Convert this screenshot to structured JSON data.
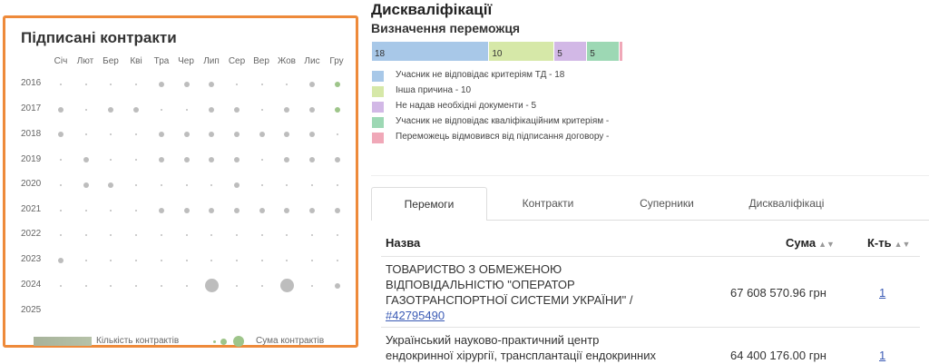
{
  "contracts_chart": {
    "title": "Підписані контракти",
    "months": [
      "Січ",
      "Лют",
      "Бер",
      "Кві",
      "Тра",
      "Чер",
      "Лип",
      "Сер",
      "Вер",
      "Жов",
      "Лис",
      "Гру"
    ],
    "years": [
      "2016",
      "2017",
      "2018",
      "2019",
      "2020",
      "2021",
      "2022",
      "2023",
      "2024",
      "2025"
    ],
    "legend_count_label": "Кількість контрактів",
    "legend_sum_label": "Сума контрактів",
    "colors": {
      "small": "#bdbdbd",
      "green": "#9ec58a",
      "border": "#ee8a3a"
    }
  },
  "chart_data": {
    "type": "scatter",
    "title": "Підписані контракти",
    "x_categories": [
      "Січ",
      "Лют",
      "Бер",
      "Кві",
      "Тра",
      "Чер",
      "Лип",
      "Сер",
      "Вер",
      "Жов",
      "Лис",
      "Гру"
    ],
    "y_categories": [
      "2016",
      "2017",
      "2018",
      "2019",
      "2020",
      "2021",
      "2022",
      "2023",
      "2024",
      "2025"
    ],
    "points": [
      {
        "year": "2016",
        "month": "Січ",
        "size": 1
      },
      {
        "year": "2016",
        "month": "Лют",
        "size": 1
      },
      {
        "year": "2016",
        "month": "Бер",
        "size": 1
      },
      {
        "year": "2016",
        "month": "Кві",
        "size": 1
      },
      {
        "year": "2016",
        "month": "Тра",
        "size": 2
      },
      {
        "year": "2016",
        "month": "Чер",
        "size": 2
      },
      {
        "year": "2016",
        "month": "Лип",
        "size": 2
      },
      {
        "year": "2016",
        "month": "Сер",
        "size": 1
      },
      {
        "year": "2016",
        "month": "Вер",
        "size": 1
      },
      {
        "year": "2016",
        "month": "Жов",
        "size": 1
      },
      {
        "year": "2016",
        "month": "Лис",
        "size": 2
      },
      {
        "year": "2016",
        "month": "Гру",
        "size": 2,
        "green": true
      },
      {
        "year": "2017",
        "month": "Січ",
        "size": 2
      },
      {
        "year": "2017",
        "month": "Лют",
        "size": 1
      },
      {
        "year": "2017",
        "month": "Бер",
        "size": 2
      },
      {
        "year": "2017",
        "month": "Кві",
        "size": 2
      },
      {
        "year": "2017",
        "month": "Тра",
        "size": 1
      },
      {
        "year": "2017",
        "month": "Чер",
        "size": 1
      },
      {
        "year": "2017",
        "month": "Лип",
        "size": 2
      },
      {
        "year": "2017",
        "month": "Сер",
        "size": 2
      },
      {
        "year": "2017",
        "month": "Вер",
        "size": 1
      },
      {
        "year": "2017",
        "month": "Жов",
        "size": 2
      },
      {
        "year": "2017",
        "month": "Лис",
        "size": 2
      },
      {
        "year": "2017",
        "month": "Гру",
        "size": 2,
        "green": true
      },
      {
        "year": "2018",
        "month": "Січ",
        "size": 2
      },
      {
        "year": "2018",
        "month": "Лют",
        "size": 1
      },
      {
        "year": "2018",
        "month": "Бер",
        "size": 1
      },
      {
        "year": "2018",
        "month": "Кві",
        "size": 1
      },
      {
        "year": "2018",
        "month": "Тра",
        "size": 2
      },
      {
        "year": "2018",
        "month": "Чер",
        "size": 2
      },
      {
        "year": "2018",
        "month": "Лип",
        "size": 2
      },
      {
        "year": "2018",
        "month": "Сер",
        "size": 2
      },
      {
        "year": "2018",
        "month": "Вер",
        "size": 2
      },
      {
        "year": "2018",
        "month": "Жов",
        "size": 2
      },
      {
        "year": "2018",
        "month": "Лис",
        "size": 2
      },
      {
        "year": "2018",
        "month": "Гру",
        "size": 1
      },
      {
        "year": "2019",
        "month": "Січ",
        "size": 1
      },
      {
        "year": "2019",
        "month": "Лют",
        "size": 2
      },
      {
        "year": "2019",
        "month": "Бер",
        "size": 1
      },
      {
        "year": "2019",
        "month": "Кві",
        "size": 1
      },
      {
        "year": "2019",
        "month": "Тра",
        "size": 2
      },
      {
        "year": "2019",
        "month": "Чер",
        "size": 2
      },
      {
        "year": "2019",
        "month": "Лип",
        "size": 2
      },
      {
        "year": "2019",
        "month": "Сер",
        "size": 2
      },
      {
        "year": "2019",
        "month": "Вер",
        "size": 1
      },
      {
        "year": "2019",
        "month": "Жов",
        "size": 2
      },
      {
        "year": "2019",
        "month": "Лис",
        "size": 2
      },
      {
        "year": "2019",
        "month": "Гру",
        "size": 2
      },
      {
        "year": "2020",
        "month": "Січ",
        "size": 1
      },
      {
        "year": "2020",
        "month": "Лют",
        "size": 2
      },
      {
        "year": "2020",
        "month": "Бер",
        "size": 2
      },
      {
        "year": "2020",
        "month": "Кві",
        "size": 1
      },
      {
        "year": "2020",
        "month": "Тра",
        "size": 1
      },
      {
        "year": "2020",
        "month": "Чер",
        "size": 1
      },
      {
        "year": "2020",
        "month": "Лип",
        "size": 1
      },
      {
        "year": "2020",
        "month": "Сер",
        "size": 2
      },
      {
        "year": "2020",
        "month": "Вер",
        "size": 1
      },
      {
        "year": "2020",
        "month": "Жов",
        "size": 1
      },
      {
        "year": "2020",
        "month": "Лис",
        "size": 1
      },
      {
        "year": "2020",
        "month": "Гру",
        "size": 1
      },
      {
        "year": "2021",
        "month": "Січ",
        "size": 1
      },
      {
        "year": "2021",
        "month": "Лют",
        "size": 1
      },
      {
        "year": "2021",
        "month": "Бер",
        "size": 1
      },
      {
        "year": "2021",
        "month": "Кві",
        "size": 1
      },
      {
        "year": "2021",
        "month": "Тра",
        "size": 2
      },
      {
        "year": "2021",
        "month": "Чер",
        "size": 2
      },
      {
        "year": "2021",
        "month": "Лип",
        "size": 2
      },
      {
        "year": "2021",
        "month": "Сер",
        "size": 2
      },
      {
        "year": "2021",
        "month": "Вер",
        "size": 2
      },
      {
        "year": "2021",
        "month": "Жов",
        "size": 2
      },
      {
        "year": "2021",
        "month": "Лис",
        "size": 2
      },
      {
        "year": "2021",
        "month": "Гру",
        "size": 2
      },
      {
        "year": "2022",
        "month": "Січ",
        "size": 1
      },
      {
        "year": "2022",
        "month": "Лют",
        "size": 1
      },
      {
        "year": "2022",
        "month": "Бер",
        "size": 1
      },
      {
        "year": "2022",
        "month": "Кві",
        "size": 1
      },
      {
        "year": "2022",
        "month": "Тра",
        "size": 1
      },
      {
        "year": "2022",
        "month": "Чер",
        "size": 1
      },
      {
        "year": "2022",
        "month": "Лип",
        "size": 1
      },
      {
        "year": "2022",
        "month": "Сер",
        "size": 1
      },
      {
        "year": "2022",
        "month": "Вер",
        "size": 1
      },
      {
        "year": "2022",
        "month": "Жов",
        "size": 1
      },
      {
        "year": "2022",
        "month": "Лис",
        "size": 1
      },
      {
        "year": "2022",
        "month": "Гру",
        "size": 1
      },
      {
        "year": "2023",
        "month": "Січ",
        "size": 2
      },
      {
        "year": "2023",
        "month": "Лют",
        "size": 1
      },
      {
        "year": "2023",
        "month": "Бер",
        "size": 1
      },
      {
        "year": "2023",
        "month": "Кві",
        "size": 1
      },
      {
        "year": "2023",
        "month": "Тра",
        "size": 1
      },
      {
        "year": "2023",
        "month": "Чер",
        "size": 1
      },
      {
        "year": "2023",
        "month": "Лип",
        "size": 1
      },
      {
        "year": "2023",
        "month": "Сер",
        "size": 1
      },
      {
        "year": "2023",
        "month": "Вер",
        "size": 1
      },
      {
        "year": "2023",
        "month": "Жов",
        "size": 1
      },
      {
        "year": "2023",
        "month": "Лис",
        "size": 1
      },
      {
        "year": "2023",
        "month": "Гру",
        "size": 1
      },
      {
        "year": "2024",
        "month": "Січ",
        "size": 1
      },
      {
        "year": "2024",
        "month": "Лют",
        "size": 1
      },
      {
        "year": "2024",
        "month": "Бер",
        "size": 1
      },
      {
        "year": "2024",
        "month": "Кві",
        "size": 1
      },
      {
        "year": "2024",
        "month": "Тра",
        "size": 1
      },
      {
        "year": "2024",
        "month": "Чер",
        "size": 1
      },
      {
        "year": "2024",
        "month": "Лип",
        "size": 4
      },
      {
        "year": "2024",
        "month": "Сер",
        "size": 1
      },
      {
        "year": "2024",
        "month": "Вер",
        "size": 1
      },
      {
        "year": "2024",
        "month": "Жов",
        "size": 4
      },
      {
        "year": "2024",
        "month": "Лис",
        "size": 1
      },
      {
        "year": "2024",
        "month": "Гру",
        "size": 2
      }
    ]
  },
  "disq": {
    "title": "Дискваліфікації",
    "subtitle": "Визначення переможця",
    "segments": [
      {
        "value": 18,
        "label": "18",
        "color": "#a8c8e8"
      },
      {
        "value": 10,
        "label": "10",
        "color": "#d6e8a8"
      },
      {
        "value": 5,
        "label": "5",
        "color": "#d2b8e6"
      },
      {
        "value": 5,
        "label": "5",
        "color": "#9dd8b4"
      },
      {
        "value": 0.4,
        "label": "",
        "color": "#f0a8b8"
      }
    ],
    "legend": [
      {
        "label": "Учасник не відповідає критеріям ТД - 18",
        "color": "#a8c8e8"
      },
      {
        "label": "Інша причина - 10",
        "color": "#d6e8a8"
      },
      {
        "label": "Не надав необхідні документи - 5",
        "color": "#d2b8e6"
      },
      {
        "label": "Учасник не відповідає кваліфікаційним критеріям -",
        "color": "#9dd8b4"
      },
      {
        "label": "Переможець відмовився від підписання договору -",
        "color": "#f0a8b8"
      }
    ]
  },
  "tabs": [
    "Перемоги",
    "Контракти",
    "Суперники",
    "Дискваліфікаці"
  ],
  "table": {
    "headers": {
      "name": "Назва",
      "sum": "Сума",
      "count": "К-ть"
    },
    "rows": [
      {
        "name_line1": "ТОВАРИСТВО З ОБМЕЖЕНОЮ",
        "name_line2": "ВІДПОВІДАЛЬНІСТЮ \"ОПЕРАТОР",
        "name_line3": "ГАЗОТРАНСПОРТНОЇ СИСТЕМИ УКРАЇНИ\" /",
        "name_link": "#42795490",
        "sum": "67 608 570.96 грн",
        "count": "1"
      },
      {
        "name_line1": "Український науково-практичний центр",
        "name_line2": "ендокринної хірургії, трансплантації ендокринних",
        "sum": "64 400 176.00 грн",
        "count": "1"
      }
    ]
  }
}
